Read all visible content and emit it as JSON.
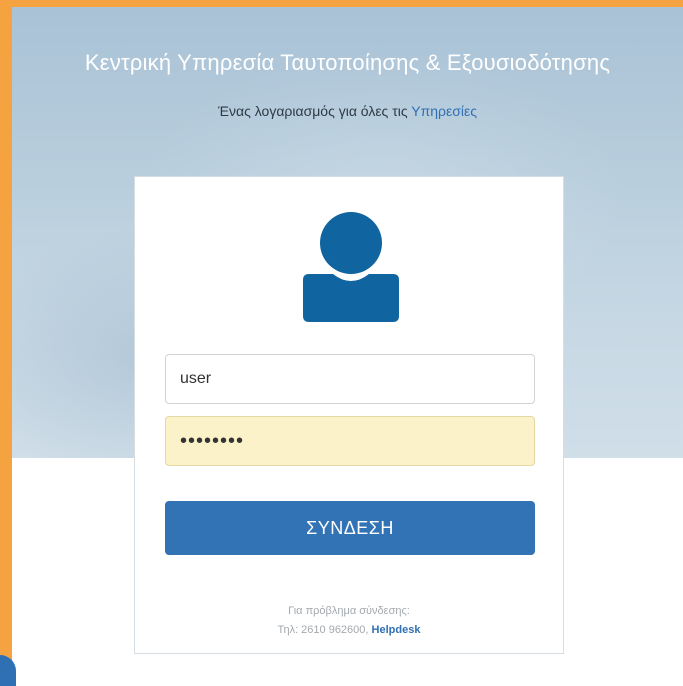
{
  "header": {
    "title": "Κεντρική Υπηρεσία Ταυτοποίησης & Εξουσιοδότησης",
    "subtitle_prefix": "Ένας λογαριασμός για όλες τις ",
    "subtitle_link": "Υπηρεσίες"
  },
  "login": {
    "username_value": "user",
    "password_value": "••••••••",
    "submit_label": "ΣΥΝΔΕΣΗ",
    "avatar_icon": "user-icon"
  },
  "help": {
    "line1": "Για πρόβλημα σύνδεσης:",
    "phone": "Τηλ: 2610 962600, ",
    "helpdesk_label": "Helpdesk"
  },
  "colors": {
    "accent": "#3273b6",
    "frame": "#f4a340",
    "avatar": "#10649f",
    "password_bg": "#fbf2c9"
  }
}
